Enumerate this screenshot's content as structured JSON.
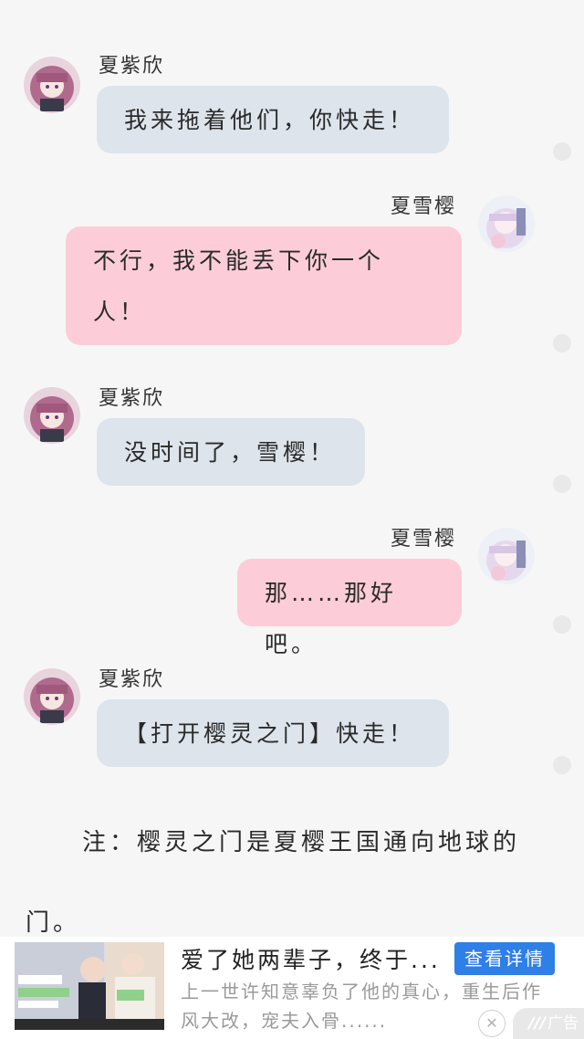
{
  "messages": [
    {
      "sender": "夏紫欣",
      "side": "left",
      "text": "我来拖着他们，你快走！"
    },
    {
      "sender": "夏雪樱",
      "side": "right",
      "text_line1": "不行，我不能丢下你一个",
      "text_line2": "人！"
    },
    {
      "sender": "夏紫欣",
      "side": "left",
      "text": "没时间了，雪樱！"
    },
    {
      "sender": "夏雪樱",
      "side": "right",
      "text": "那……那好吧。"
    },
    {
      "sender": "夏紫欣",
      "side": "left",
      "text": "【打开樱灵之门】快走！"
    }
  ],
  "note": {
    "line1": "注：樱灵之门是夏樱王国通向地球的",
    "line2": "门。"
  },
  "ad": {
    "title": "爱了她两辈子，终于...",
    "button_label": "查看详情",
    "description": "上一世许知意辜负了他的真心，重生后作风大改，宠夫入骨......",
    "close_symbol": "✕",
    "tag_label": "广告"
  },
  "colors": {
    "left_bubble": "#dde4ec",
    "right_bubble": "#fccdd8",
    "ad_button": "#2e7fe6"
  }
}
